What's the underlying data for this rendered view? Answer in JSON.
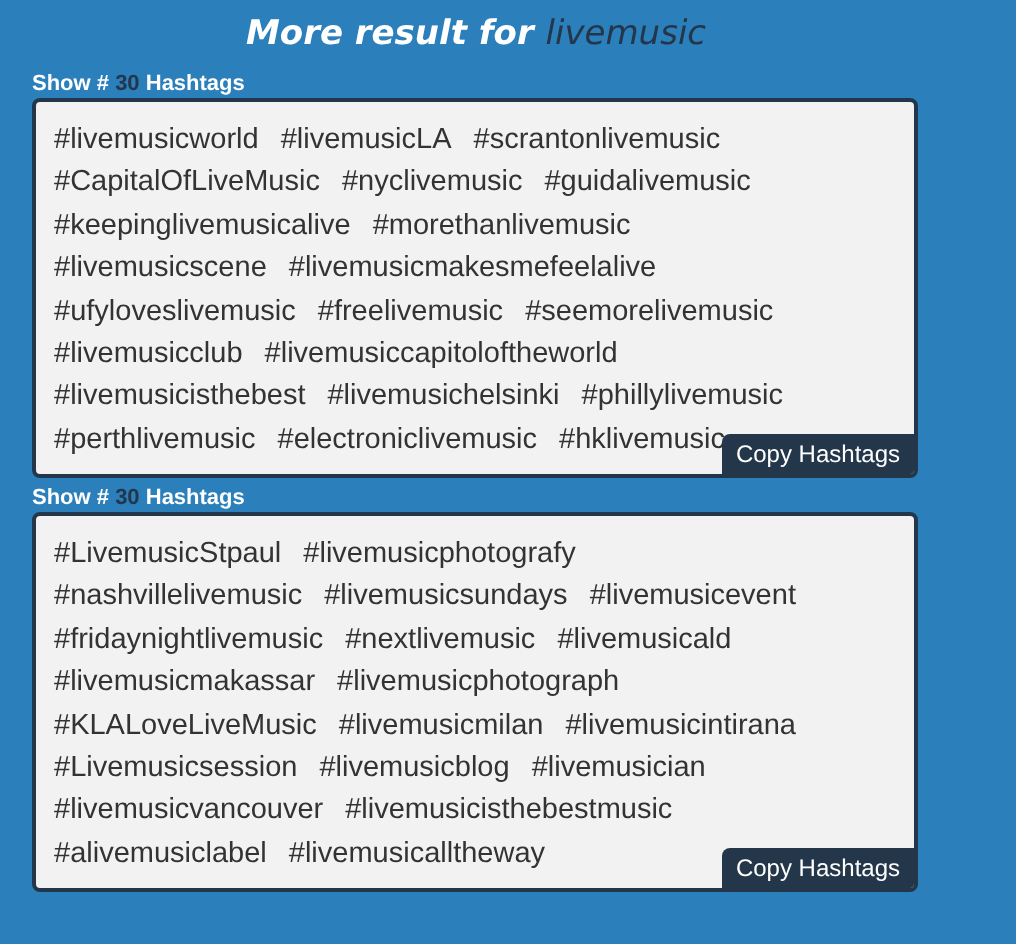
{
  "title": {
    "text": "More result for ",
    "keyword": "livemusic"
  },
  "groups": [
    {
      "label_prefix": "Show #",
      "count": "30",
      "label_suffix": "Hashtags",
      "button": "Copy Hashtags",
      "lines": [
        [
          "#livemusicworld",
          "#livemusicLA",
          "#scrantonlivemusic"
        ],
        [
          "#CapitalOfLiveMusic",
          "#nyclivemusic",
          "#guidalivemusic"
        ],
        [
          "#keepinglivemusicalive",
          "#morethanlivemusic"
        ],
        [
          "#livemusicscene",
          "#livemusicmakesmefeelalive"
        ],
        [
          "#ufyloveslivemusic",
          "#freelivemusic",
          "#seemorelivemusic"
        ],
        [
          "#livemusicclub",
          "#livemusiccapitoloftheworld"
        ],
        [
          "#livemusicisthebest",
          "#livemusichelsinki",
          "#phillylivemusic"
        ],
        [
          "#perthlivemusic",
          "#electroniclivemusic",
          "#hklivemusic"
        ]
      ]
    },
    {
      "label_prefix": "Show #",
      "count": "30",
      "label_suffix": "Hashtags",
      "button": "Copy Hashtags",
      "lines": [
        [
          "#LivemusicStpaul",
          "#livemusicphotografy"
        ],
        [
          "#nashvillelivemusic",
          "#livemusicsundays",
          "#livemusicevent"
        ],
        [
          "#fridaynightlivemusic",
          "#nextlivemusic",
          "#livemusicald"
        ],
        [
          "#livemusicmakassar",
          "#livemusicphotograph"
        ],
        [
          "#KLALoveLiveMusic",
          "#livemusicmilan",
          "#livemusicintirana"
        ],
        [
          "#Livemusicsession",
          "#livemusicblog",
          "#livemusician"
        ],
        [
          "#livemusicvancouver",
          "#livemusicisthebestmusic"
        ],
        [
          "#alivemusiclabel",
          "#livemusicalltheway"
        ]
      ]
    }
  ]
}
